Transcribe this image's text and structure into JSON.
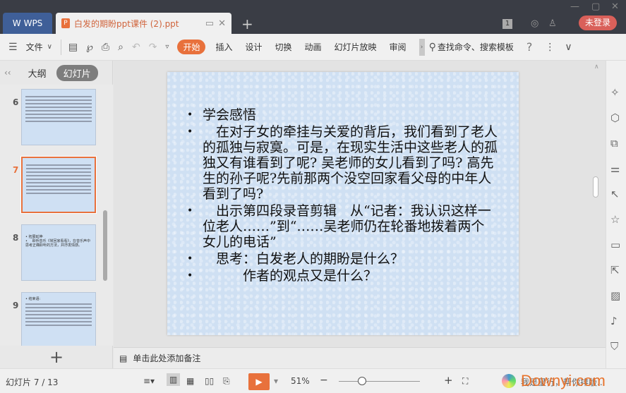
{
  "titlebar": {
    "wps_label": "WPS",
    "doc_tab_title": "白发的期盼ppt课件 (2).ppt",
    "new_tab": "+",
    "badge": "1",
    "login": "未登录"
  },
  "toolbar": {
    "file": "文件",
    "tabs": [
      "开始",
      "插入",
      "设计",
      "切换",
      "动画",
      "幻灯片放映",
      "审阅"
    ],
    "search": "查找命令、搜索模板",
    "help": "?"
  },
  "left_panel": {
    "tab_outline": "大纲",
    "tab_slides": "幻灯片",
    "add": "+",
    "thumbnails": [
      {
        "num": "6"
      },
      {
        "num": "7",
        "selected": true
      },
      {
        "num": "8",
        "lines": [
          "• 拓展延伸",
          "• 　聆听音乐《常回家看看》，在音乐声中思考正确聆听的方法，并抒发情感。"
        ]
      },
      {
        "num": "9",
        "lines": [
          "• 结束语:"
        ]
      }
    ]
  },
  "slide": {
    "bullets": [
      "学会感悟",
      "　在对子女的牵挂与关爱的背后，我们看到了老人的孤独与寂寞。可是，在现实生活中这些老人的孤独又有谁看到了呢? 吴老师的女儿看到了吗? 高先生的孙子呢?先前那两个没空回家看父母的中年人看到了吗?",
      "　出示第四段录音剪辑　从“记者：我认识这样一位老人……”到“……吴老师仍在轮番地拨着两个女儿的电话”",
      "　思考：白发老人的期盼是什么？",
      "　　　作者的观点又是什么？"
    ]
  },
  "notes": {
    "placeholder": "单击此处添加备注"
  },
  "status": {
    "slide_counter": "幻灯片 7 / 13",
    "zoom": "51%",
    "minus": "−",
    "plus": "+",
    "assistant": "我是星行，帮你排版...",
    "watermark": "Downyi.com"
  },
  "colors": {
    "accent": "#e8713c",
    "titlebar": "#3a3d45",
    "wps_blue": "#3f5f98",
    "login": "#d9605a"
  }
}
